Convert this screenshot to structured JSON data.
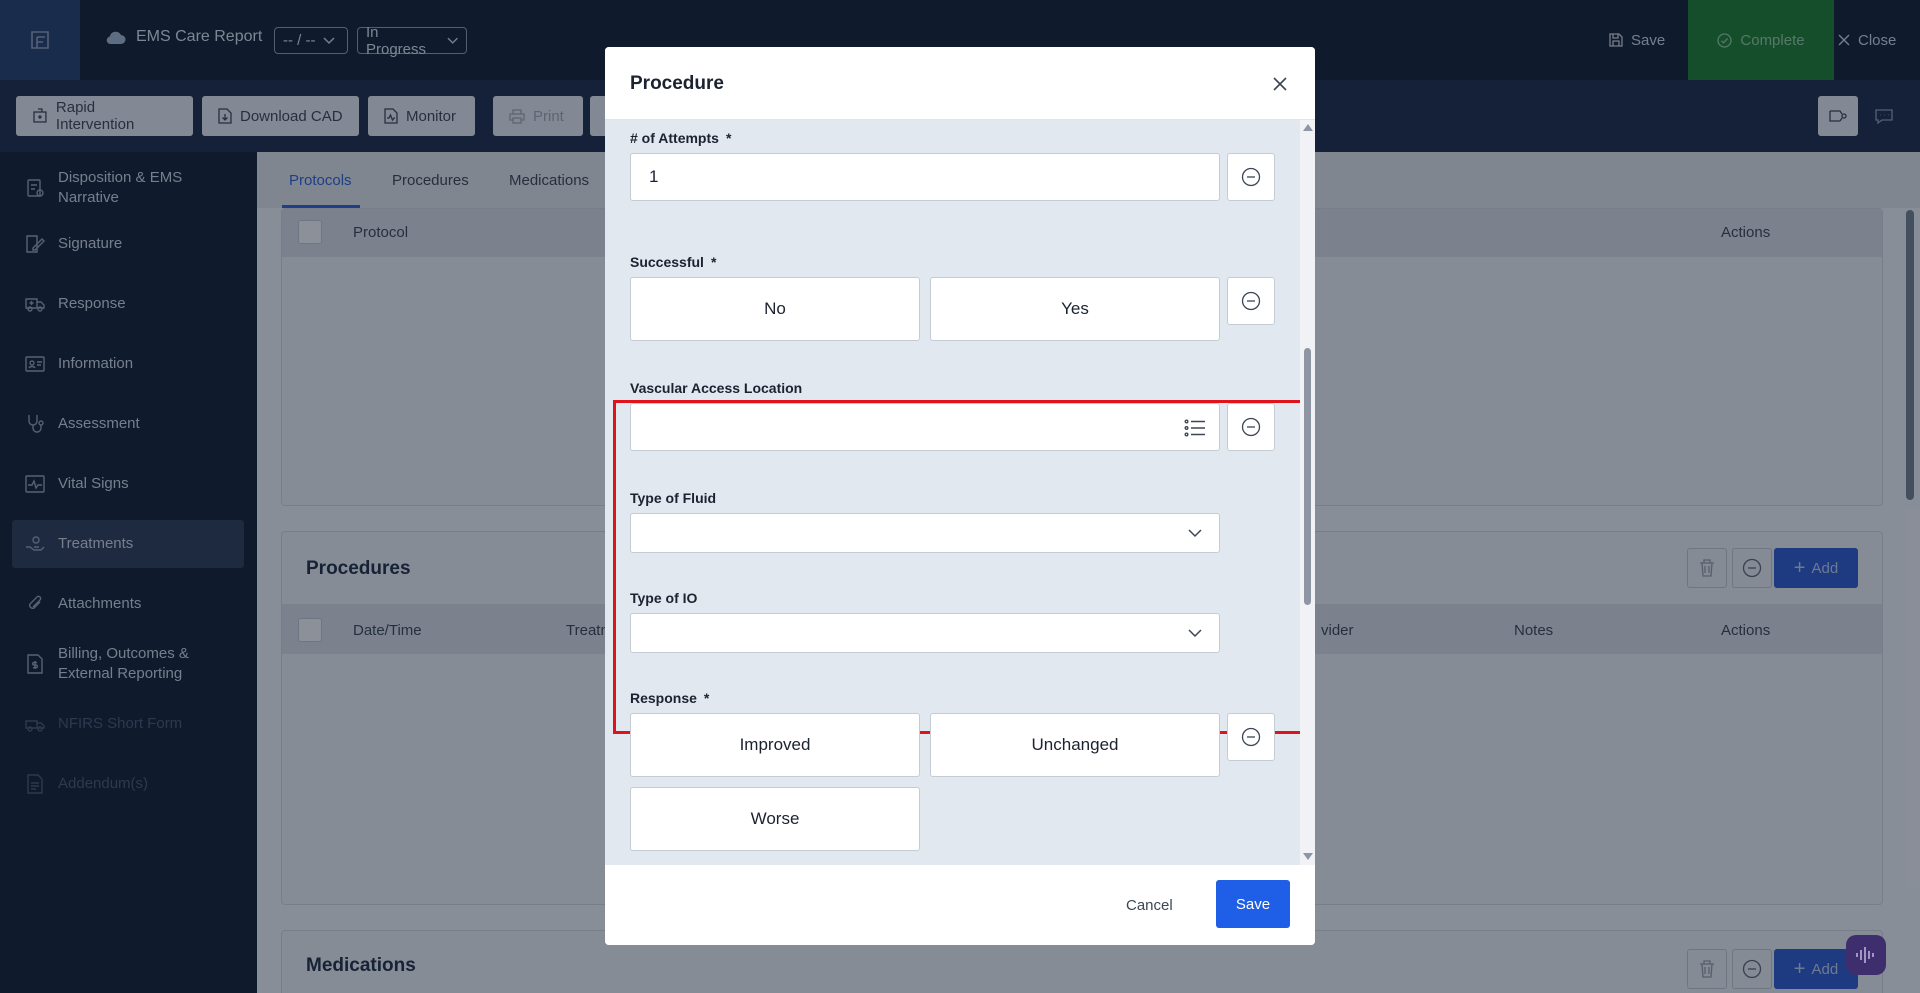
{
  "header": {
    "app_title": "EMS Care Report",
    "date_select": "-- / --",
    "status_select": "In Progress",
    "save_label": "Save",
    "complete_label": "Complete",
    "close_label": "Close"
  },
  "toolbar": {
    "rapid_intervention": "Rapid Intervention",
    "download_cad": "Download CAD",
    "monitor": "Monitor",
    "print": "Print"
  },
  "sidebar": {
    "items": [
      {
        "label": "Disposition & EMS Narrative",
        "icon": "clipboard-icon"
      },
      {
        "label": "Signature",
        "icon": "signature-icon"
      },
      {
        "label": "Response",
        "icon": "ambulance-icon"
      },
      {
        "label": "Information",
        "icon": "id-card-icon"
      },
      {
        "label": "Assessment",
        "icon": "stethoscope-icon"
      },
      {
        "label": "Vital Signs",
        "icon": "pulse-icon"
      },
      {
        "label": "Treatments",
        "icon": "hand-care-icon"
      },
      {
        "label": "Attachments",
        "icon": "paperclip-icon"
      },
      {
        "label": "Billing, Outcomes & External Reporting",
        "icon": "document-dollar-icon"
      },
      {
        "label": "NFIRS Short Form",
        "icon": "fire-truck-icon"
      },
      {
        "label": "Addendum(s)",
        "icon": "document-list-icon"
      }
    ]
  },
  "tabs": [
    {
      "label": "Protocols"
    },
    {
      "label": "Procedures"
    },
    {
      "label": "Medications"
    }
  ],
  "protocols_table": {
    "col_protocol": "Protocol",
    "col_actions": "Actions"
  },
  "procedures_section": {
    "title": "Procedures",
    "add_label": "Add",
    "col_datetime": "Date/Time",
    "col_treatment": "Treatm",
    "col_provider": "vider",
    "col_notes": "Notes",
    "col_actions": "Actions"
  },
  "medications_section": {
    "title": "Medications",
    "add_label": "Add"
  },
  "modal": {
    "title": "Procedure",
    "attempts": {
      "label": "# of Attempts",
      "required": "*",
      "value": "1"
    },
    "successful": {
      "label": "Successful",
      "required": "*",
      "options": [
        "No",
        "Yes"
      ]
    },
    "vascular_access": {
      "label": "Vascular Access Location",
      "value": ""
    },
    "fluid_type": {
      "label": "Type of Fluid",
      "value": ""
    },
    "io_type": {
      "label": "Type of IO",
      "value": ""
    },
    "response": {
      "label": "Response",
      "required": "*",
      "options": [
        "Improved",
        "Unchanged",
        "Worse"
      ]
    },
    "cancel_label": "Cancel",
    "save_label": "Save"
  },
  "colors": {
    "highlight": "#e0121b",
    "primary": "#1f5ee6",
    "complete": "#1f7a35"
  }
}
